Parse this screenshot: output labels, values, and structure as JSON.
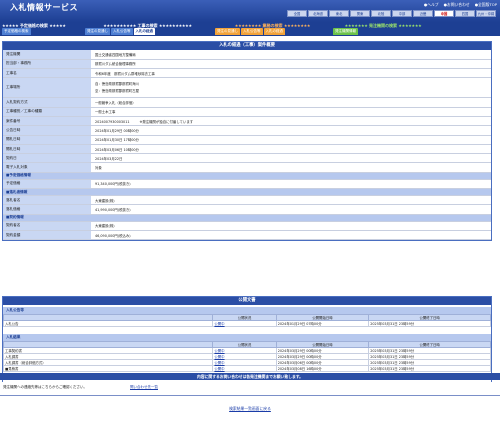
{
  "header": {
    "title": "入札情報サービス",
    "links": [
      "●ヘルプ",
      "●お問い合わせ",
      "●全国版TOP"
    ],
    "regions": [
      {
        "label": "全国",
        "active": false
      },
      {
        "label": "北海道",
        "active": false
      },
      {
        "label": "東北",
        "active": false
      },
      {
        "label": "関東",
        "active": false
      },
      {
        "label": "北陸",
        "active": false
      },
      {
        "label": "中部",
        "active": false
      },
      {
        "label": "近畿",
        "active": false
      },
      {
        "label": "中国",
        "active": true
      },
      {
        "label": "四国",
        "active": false
      },
      {
        "label": "九州・沖縄",
        "active": false
      }
    ]
  },
  "nav": {
    "groups": [
      {
        "title": "予定価格の検索",
        "buttons": [
          "予定価格の検索"
        ]
      },
      {
        "title": "工事の検索",
        "buttons": [
          "発注の見通し",
          "入札公告等",
          "入札の経過"
        ],
        "selected": 2
      },
      {
        "title": "業務の検索",
        "buttons": [
          "発注の見通し",
          "入札公告等",
          "入札の経過"
        ]
      },
      {
        "title": "発注機関の検索",
        "buttons": [
          "発注機関情報"
        ]
      }
    ]
  },
  "panel": {
    "title": "入札の経過（工事）案件概要",
    "rows": [
      {
        "k": "発注機関",
        "v": "国土交通省四国地方整備局"
      },
      {
        "k": "担当部・事務所",
        "v": "那賀川ダム統合管理事務所"
      },
      {
        "k": "工事名",
        "v": "令和6年度　那賀川ダム群堆砂除去工事"
      },
      {
        "k": "工事場所",
        "v": [
          "自：徳島県那賀郡那賀町海川",
          "至：徳島県那賀郡那賀町古屋"
        ],
        "tall": true
      },
      {
        "k": "入札契約方式",
        "v": "一般競争入札（総合評価）"
      },
      {
        "k": "工事種別／工事の種類",
        "v": "一般土木工事"
      },
      {
        "k": "案件番号",
        "v": "2024007930003011",
        "note": "※発注機関が独自に付番しています"
      },
      {
        "k": "公告日時",
        "v": "2024年01月29日 00時00分"
      },
      {
        "k": "開札日時",
        "v": "2024年01月30日 17時00分"
      },
      {
        "k": "開札日時",
        "v": "2024年03月06日 10時00分"
      },
      {
        "k": "契約日",
        "v": "2024年03月22日"
      },
      {
        "k": "電子入札対象",
        "v": "対象"
      }
    ],
    "section1": "■予定価格情報",
    "rows2": [
      {
        "k": "予定価格",
        "v": "91,340,000円(税抜き)"
      }
    ],
    "section2": "■落札者情報",
    "rows3": [
      {
        "k": "落札者名",
        "v": "大東建設(株)"
      },
      {
        "k": "落札価格",
        "v": "41,990,000円(税抜き)"
      }
    ],
    "section3": "■契約情報",
    "rows4": [
      {
        "k": "契約者名",
        "v": "大東建設(株)"
      },
      {
        "k": "契約金額",
        "v": "46,090,000円(税込み)"
      }
    ]
  },
  "docs": {
    "title": "公開文書",
    "columns": [
      "",
      "公開状況",
      "公開開始日時",
      "公開終了日時"
    ],
    "sections": [
      {
        "title": "入札公告等",
        "rows": [
          [
            "入札公告",
            "公開中",
            "2024年01月29日 07時00分",
            "2025年03月31日 23時59分"
          ]
        ]
      },
      {
        "title": "入札結果",
        "rows": [
          [
            "工事契約書",
            "公開中",
            "2024年03月29日 00時00分",
            "2025年03月31日 23時59分"
          ],
          [
            "入札調書",
            "公開中",
            "2024年03月29日 00時00分",
            "2025年03月31日 23時59分"
          ],
          [
            "入札調書（総合評価方式）",
            "公開中",
            "2024年03月06日 00時00分",
            "2025年03月31日 23時59分"
          ],
          [
            "■見積書",
            "公開中",
            "2024年03月08日 16時00分",
            "2025年03月31日 23時59分"
          ]
        ]
      }
    ]
  },
  "footer": {
    "contact_bar": "内容に関するお問い合わせは各発注機関までお願い致します。",
    "contact_text": "発注機関への連絡先等はこちらからご確認ください。",
    "contact_link": "問い合わせ先一覧",
    "back_link": "検索結果一覧画面に戻る"
  }
}
